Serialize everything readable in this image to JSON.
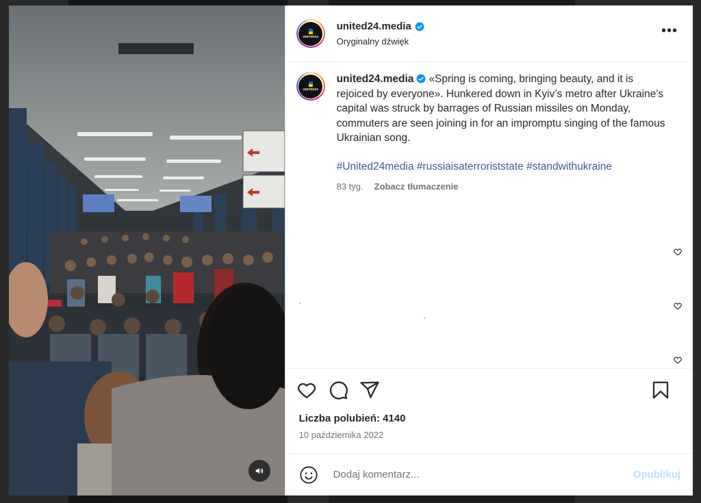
{
  "header": {
    "username": "united24.media",
    "subtitle": "Oryginalny dźwięk",
    "more_icon": "more-horizontal-icon",
    "logo_text": "UNITED24"
  },
  "caption": {
    "username": "united24.media",
    "text": "«Spring is coming, bringing beauty, and it is rejoiced by everyone». Hunkered down in Kyiv’s metro after Ukraine’s capital was struck by barrages of Russian missiles on Monday, commuters are seen joining in for an impromptu singing of the famous Ukrainian song.",
    "hashtags": [
      "#United24media",
      "#russiaisaterroriststate",
      "#standwithukraine"
    ],
    "age": "83 tyg.",
    "translate_label": "Zobacz tłumaczenie"
  },
  "stats": {
    "likes": "Liczba polubień: 4140",
    "date": "10 października 2022"
  },
  "comment": {
    "placeholder": "Dodaj komentarz...",
    "publish_label": "Opublikuj"
  },
  "colors": {
    "verified": "#0095f6",
    "hashtag": "#3d5b8c",
    "publish_disabled": "#c0dffd"
  },
  "icons": {
    "like": "heart-icon",
    "comment": "comment-icon",
    "share": "paper-plane-icon",
    "save": "bookmark-icon",
    "emoji": "smiley-icon",
    "sound": "speaker-icon"
  }
}
